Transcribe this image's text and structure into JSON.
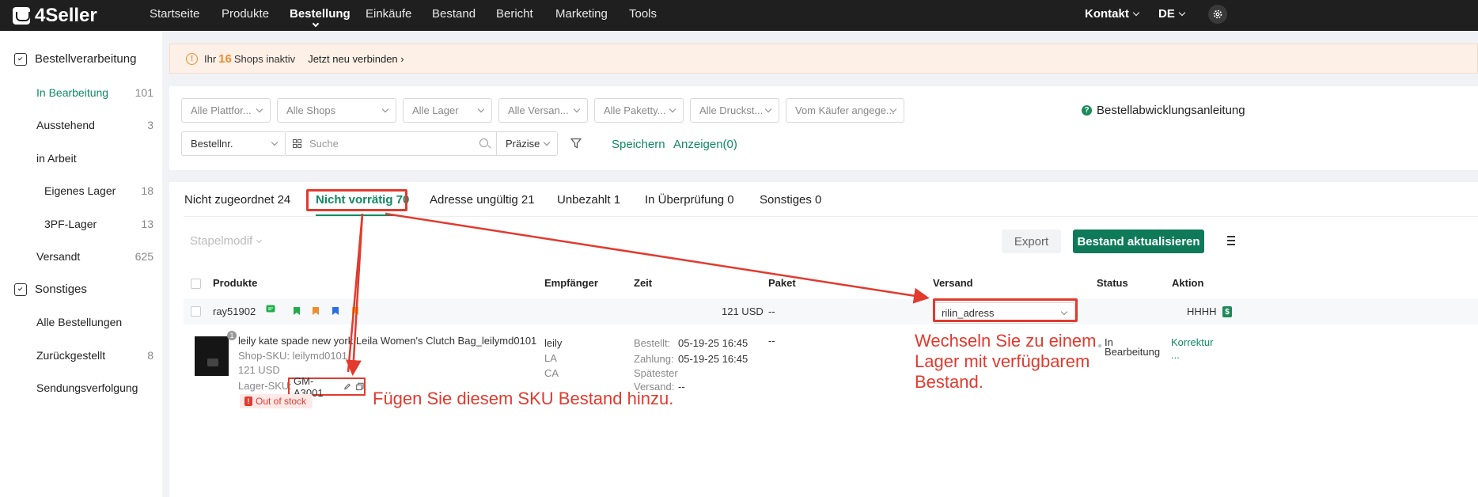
{
  "topnav": {
    "logo": "4Seller",
    "items": [
      "Startseite",
      "Produkte",
      "Bestellung",
      "Einkäufe",
      "Bestand",
      "Bericht",
      "Marketing",
      "Tools"
    ],
    "active_index": 2,
    "kontakt": "Kontakt",
    "language": "DE"
  },
  "sidebar": {
    "group1": "Bestellverarbeitung",
    "items": [
      {
        "label": "In Bearbeitung",
        "count": "101"
      },
      {
        "label": "Ausstehend",
        "count": "3"
      },
      {
        "label": "in Arbeit",
        "count": ""
      },
      {
        "label": "Eigenes Lager",
        "count": "18"
      },
      {
        "label": "3PF-Lager",
        "count": "13"
      },
      {
        "label": "Versandt",
        "count": "625"
      }
    ],
    "group2": "Sonstiges",
    "items2": [
      {
        "label": "Alle Bestellungen",
        "count": ""
      },
      {
        "label": "Zurückgestellt",
        "count": "8"
      },
      {
        "label": "Sendungsverfolgung",
        "count": ""
      }
    ]
  },
  "alert": {
    "prefix": "Ihr",
    "count": "16",
    "suffix": "Shops inaktiv",
    "link": "Jetzt neu verbinden"
  },
  "filters": {
    "selects": [
      "Alle Plattfor...",
      "Alle Shops",
      "Alle Lager",
      "Alle Versan...",
      "Alle Paketty...",
      "Alle Druckst...",
      "Vom Käufer angege..."
    ],
    "search_field": "Bestellnr.",
    "search_placeholder": "Suche",
    "precision": "Präzise",
    "save": "Speichern",
    "show": "Anzeigen(0)",
    "guide": "Bestellabwicklungsanleitung"
  },
  "tabs": [
    {
      "label": "Nicht zugeordnet 24"
    },
    {
      "label": "Nicht vorrätig 70"
    },
    {
      "label": "Adresse ungültig 21"
    },
    {
      "label": "Unbezahlt 1"
    },
    {
      "label": "In Überprüfung 0"
    },
    {
      "label": "Sonstiges 0"
    }
  ],
  "toolbar": {
    "batch": "Stapelmodif",
    "export": "Export",
    "update": "Bestand aktualisieren"
  },
  "table": {
    "headers": [
      "Produkte",
      "Empfänger",
      "Zeit",
      "Paket",
      "Versand",
      "Status",
      "Aktion"
    ],
    "order": {
      "id": "ray51902",
      "amount": "121 USD",
      "paket": "--",
      "versand": "rilin_adress",
      "aktion": "HHHH"
    },
    "item": {
      "qty": "1",
      "title": "leily kate spade new york Leila Women's Clutch Bag_leilymd0101",
      "shop_sku": "Shop-SKU: leilymd0101",
      "price": "121 USD",
      "lager_label": "Lager-SKU:",
      "lager_sku": "GM-A3001",
      "stock_badge": "Out of stock",
      "recipient": [
        "leily",
        "LA",
        "CA"
      ],
      "time": [
        {
          "label": "Bestellt:",
          "value": "05-19-25 16:45"
        },
        {
          "label": "Zahlung:",
          "value": "05-19-25 16:45"
        },
        {
          "label": "Spätester",
          "value": ""
        },
        {
          "label": "Versand:",
          "value": "--"
        }
      ],
      "paket": "--",
      "status": [
        "In",
        "Bearbeitung"
      ],
      "action": [
        "Korrektur",
        "..."
      ]
    }
  },
  "annotations": {
    "warehouse": "Wechseln Sie zu einem Lager mit verfügbarem Bestand.",
    "warehouse_lines": [
      "Wechseln Sie zu einem",
      "Lager mit verfügbarem",
      "Bestand."
    ],
    "sku": "Fügen Sie diesem SKU Bestand hinzu.",
    "color": "#e23a2e"
  },
  "colors": {
    "accent": "#0f8a62",
    "button": "#0f7a57",
    "warn": "#f08c2e",
    "nav_bg": "#1f1f1f"
  }
}
